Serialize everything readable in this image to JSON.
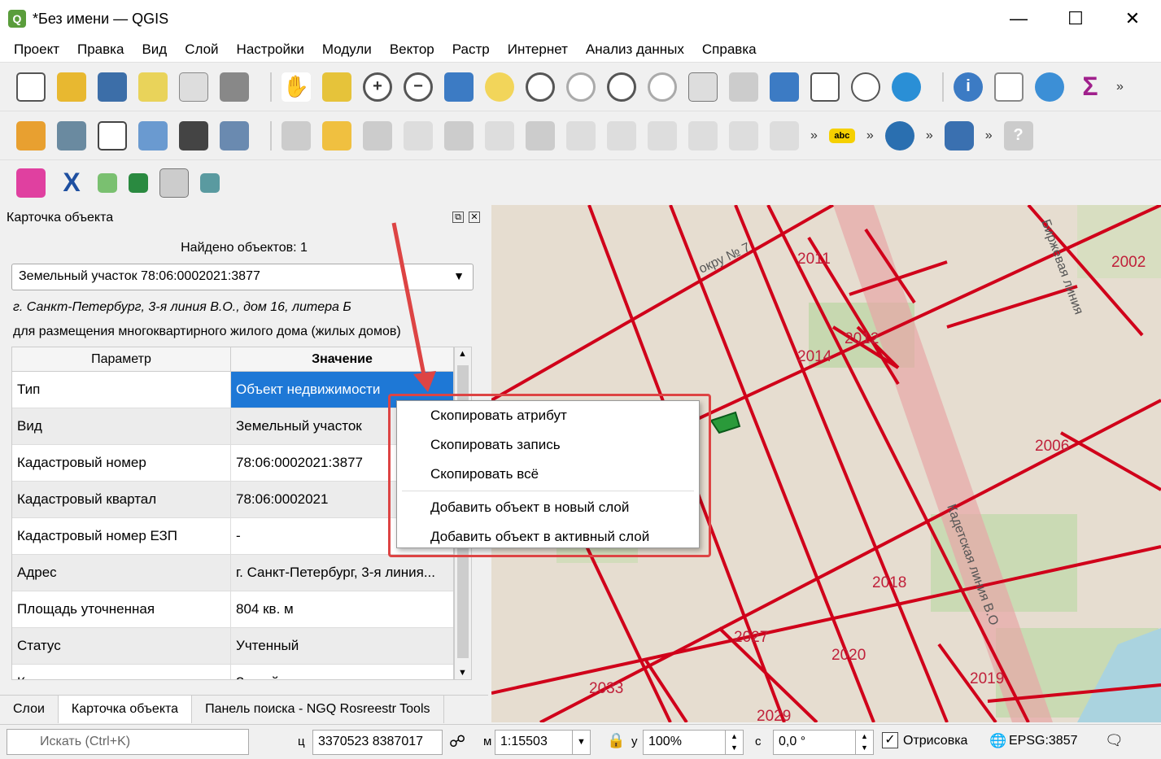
{
  "window": {
    "title": "*Без имени — QGIS",
    "app_icon": "Q",
    "minimize": "—",
    "maximize": "☐",
    "close": "✕"
  },
  "menu": [
    "Проект",
    "Правка",
    "Вид",
    "Слой",
    "Настройки",
    "Модули",
    "Вектор",
    "Растр",
    "Интернет",
    "Анализ данных",
    "Справка"
  ],
  "toolbar3": {
    "abc": "abc"
  },
  "panel": {
    "title": "Карточка объекта",
    "found": "Найдено объектов: 1",
    "combo": "Земельный участок 78:06:0002021:3877",
    "address": "г. Санкт-Петербург, 3-я линия В.О., дом 16, литера Б",
    "purpose": "для размещения многоквартирного жилого дома (жилых домов)",
    "headers": [
      "Параметр",
      "Значение"
    ],
    "rows": [
      {
        "p": "Тип",
        "v": "Объект недвижимости"
      },
      {
        "p": "Вид",
        "v": "Земельный участок"
      },
      {
        "p": "Кадастровый номер",
        "v": "78:06:0002021:3877"
      },
      {
        "p": "Кадастровый квартал",
        "v": "78:06:0002021"
      },
      {
        "p": "Кадастровый номер ЕЗП",
        "v": "-"
      },
      {
        "p": "Адрес",
        "v": "г. Санкт-Петербург, 3-я линия..."
      },
      {
        "p": "Площадь уточненная",
        "v": "804 кв. м"
      },
      {
        "p": "Статус",
        "v": "Учтенный"
      },
      {
        "p": "К...",
        "v": "З... ...й"
      }
    ]
  },
  "tabs": [
    "Слои",
    "Карточка объекта",
    "Панель поиска - NGQ Rosreestr Tools"
  ],
  "context_menu": [
    "Скопировать атрибут",
    "Скопировать запись",
    "Скопировать всё",
    "Добавить объект в новый слой",
    "Добавить объект в активный слой"
  ],
  "map_labels": [
    "2011",
    "2012",
    "2014",
    "2002",
    "2006",
    "2018",
    "2027",
    "2020",
    "2019",
    "2033",
    "2029",
    "Кадетская линия В.О",
    "Биржевая линия",
    "окру № 7"
  ],
  "status": {
    "search_placeholder": "Искать (Ctrl+K)",
    "coord_label": "ц",
    "coords": "3370523  8387017",
    "scale_label": "м",
    "scale": "1:15503",
    "zoom_label": "у",
    "zoom": "100%",
    "rot_label": "c",
    "rotation": "0,0 °",
    "render": "Отрисовка",
    "crs": "EPSG:3857"
  },
  "colors": {
    "selection": "#1e78d6",
    "parcel_line": "#d0001a",
    "highlight": "#d44444"
  }
}
